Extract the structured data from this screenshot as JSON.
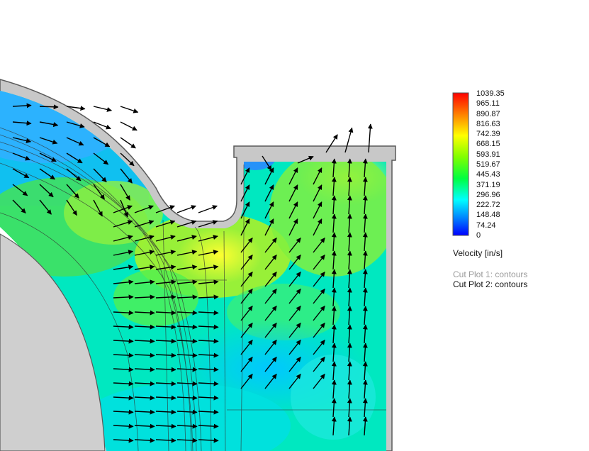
{
  "legend": {
    "title": "Velocity [in/s]",
    "ticks": [
      "1039.35",
      "965.11",
      "890.87",
      "816.63",
      "742.39",
      "668.15",
      "593.91",
      "519.67",
      "445.43",
      "371.19",
      "296.96",
      "222.72",
      "148.48",
      "74.24",
      "0"
    ],
    "min": 0,
    "max": 1039.35,
    "gradient_colors": [
      "#ff0000",
      "#ff8000",
      "#ffff00",
      "#80ff00",
      "#00ff40",
      "#00ffff",
      "#0080ff",
      "#0000ff"
    ]
  },
  "plots": [
    {
      "label": "Cut Plot 1: contours",
      "active": false
    },
    {
      "label": "Cut Plot 2: contours",
      "active": true
    }
  ],
  "colors": {
    "wall": "#c8c8c8",
    "wall_edge": "#5a5a5a",
    "background": "#ffffff",
    "inner_disc": "#cfcfcf",
    "arrow": "#000000"
  }
}
